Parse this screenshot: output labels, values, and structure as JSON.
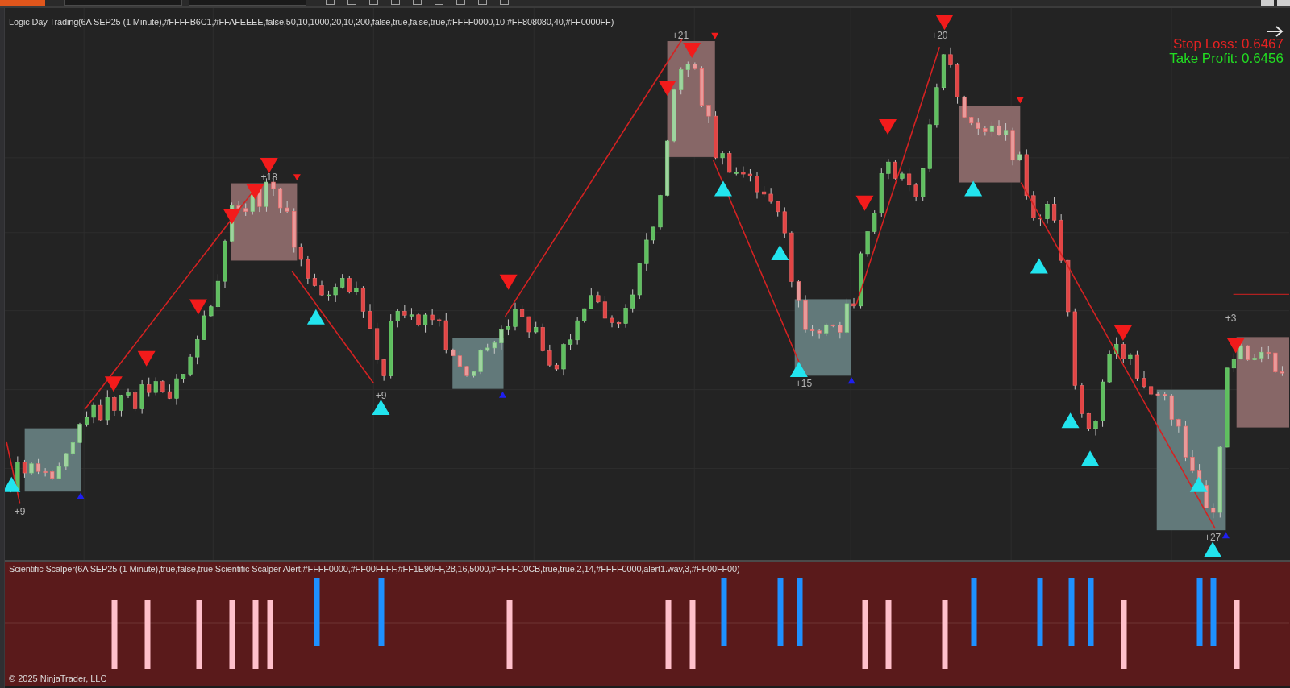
{
  "price_panel": {
    "title": "Logic Day Trading(6A SEP25 (1 Minute),#FFFFB6C1,#FFAFEEEE,false,50,10,1000,20,10,200,false,true,false,true,#FFFF0000,10,#FF808080,40,#FF0000FF)",
    "stop_loss": "Stop Loss: 0.6467",
    "take_profit": "Take Profit: 0.6456",
    "profit_labels": [
      "+9",
      "+18",
      "+9",
      "+21",
      "+15",
      "+20",
      "+27",
      "+3"
    ]
  },
  "indicator_panel": {
    "title": "Scientific Scalper(6A SEP25 (1 Minute),true,false,true,Scientific Scalper Alert,#FFFF0000,#FF00FFFF,#FF1E90FF,28,16,5000,#FFFFC0CB,true,true,2,14,#FFFF0000,alert1.wav,3,#FF00FF00)",
    "copyright": "© 2025 NinjaTrader, LLC"
  }
}
